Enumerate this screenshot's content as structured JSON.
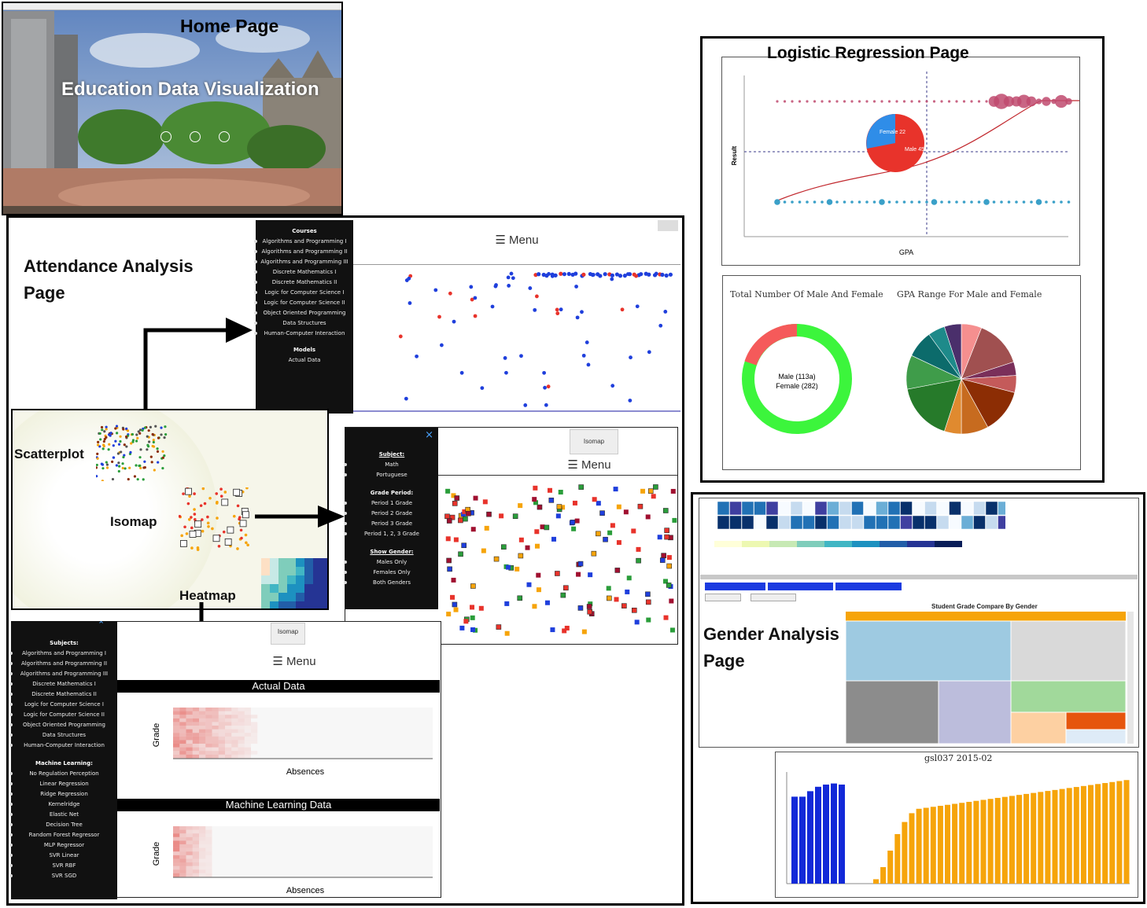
{
  "home": {
    "label": "Home Page",
    "app_title": "Education Data Visualization",
    "nav_icons": [
      "table-icon",
      "chart-icon",
      "cog-icon"
    ]
  },
  "attendance": {
    "label_line1": "Attendance Analysis",
    "label_line2": "Page",
    "menu_label": "☰ Menu",
    "courses_header": "Courses",
    "courses": [
      "Algorithms and Programming I",
      "Algorithms and Programming II",
      "Algorithms and Programming III",
      "Discrete Mathematics I",
      "Discrete Mathematics II",
      "Logic for Computer Science I",
      "Logic for Computer Science II",
      "Object Oriented Programming",
      "Data Structures",
      "Human-Computer Interaction"
    ],
    "models_header": "Models",
    "models": [
      "Actual Data"
    ]
  },
  "thumbs": {
    "scatter_label": "Scatterplot",
    "isomap_label": "Isomap",
    "heatmap_label": "Heatmap"
  },
  "isomap_panel": {
    "tab_label": "Isomap",
    "menu_label": "☰ Menu",
    "close_label": "×",
    "subject_header": "Subject:",
    "subjects": [
      "Math",
      "Portuguese"
    ],
    "period_header": "Grade Period:",
    "periods": [
      "Period 1 Grade",
      "Period 2 Grade",
      "Period 3 Grade",
      "Period 1, 2, 3 Grade"
    ],
    "gender_header": "Show Gender:",
    "genders": [
      "Males Only",
      "Females Only",
      "Both Genders"
    ]
  },
  "heatmap_panel": {
    "tab_label": "Isomap",
    "menu_label": "☰ Menu",
    "subjects_header": "Subjects:",
    "subjects": [
      "Algorithms and Programming I",
      "Algorithms and Programming II",
      "Algorithms and Programming III",
      "Discrete Mathematics I",
      "Discrete Mathematics II",
      "Logic for Computer Science I",
      "Logic for Computer Science II",
      "Object Oriented Programming",
      "Data Structures",
      "Human-Computer Interaction"
    ],
    "ml_header": "Machine Learning:",
    "ml_models": [
      "No Regulation Perception",
      "Linear Regression",
      "Ridge Regression",
      "Kernelridge",
      "Elastic Net",
      "Decision Tree",
      "Random Forest Regressor",
      "MLP Regressor",
      "SVR Linear",
      "SVR RBF",
      "SVR SGD"
    ],
    "actual_title": "Actual Data",
    "ml_title": "Machine Learning Data",
    "ylabel": "Grade",
    "xlabel": "Absences"
  },
  "logistic": {
    "label": "Logistic Regression Page",
    "xlabel": "GPA",
    "ylabel": "Result",
    "pie_female": "Female\n22",
    "pie_male": "Male\n45",
    "donut_title": "Total Number Of Male And Female",
    "donut_male": "Male (113a)",
    "donut_female": "Female (282)",
    "gpa_pie_title": "GPA Range For Male and Female"
  },
  "gender": {
    "label_line1": "Gender Analysis",
    "label_line2": "Page",
    "treemap_title": "Student Grade Compare By Gender",
    "bar_chart_title": "gsl037 2015-02"
  },
  "colors": {
    "attendance_blue": "#1f3fdc",
    "attendance_red": "#e8332b",
    "bar_blue": "#1229d8",
    "bar_orange": "#f6a40a",
    "donut_green": "#3cf53c",
    "donut_red": "#f55a5a"
  }
}
